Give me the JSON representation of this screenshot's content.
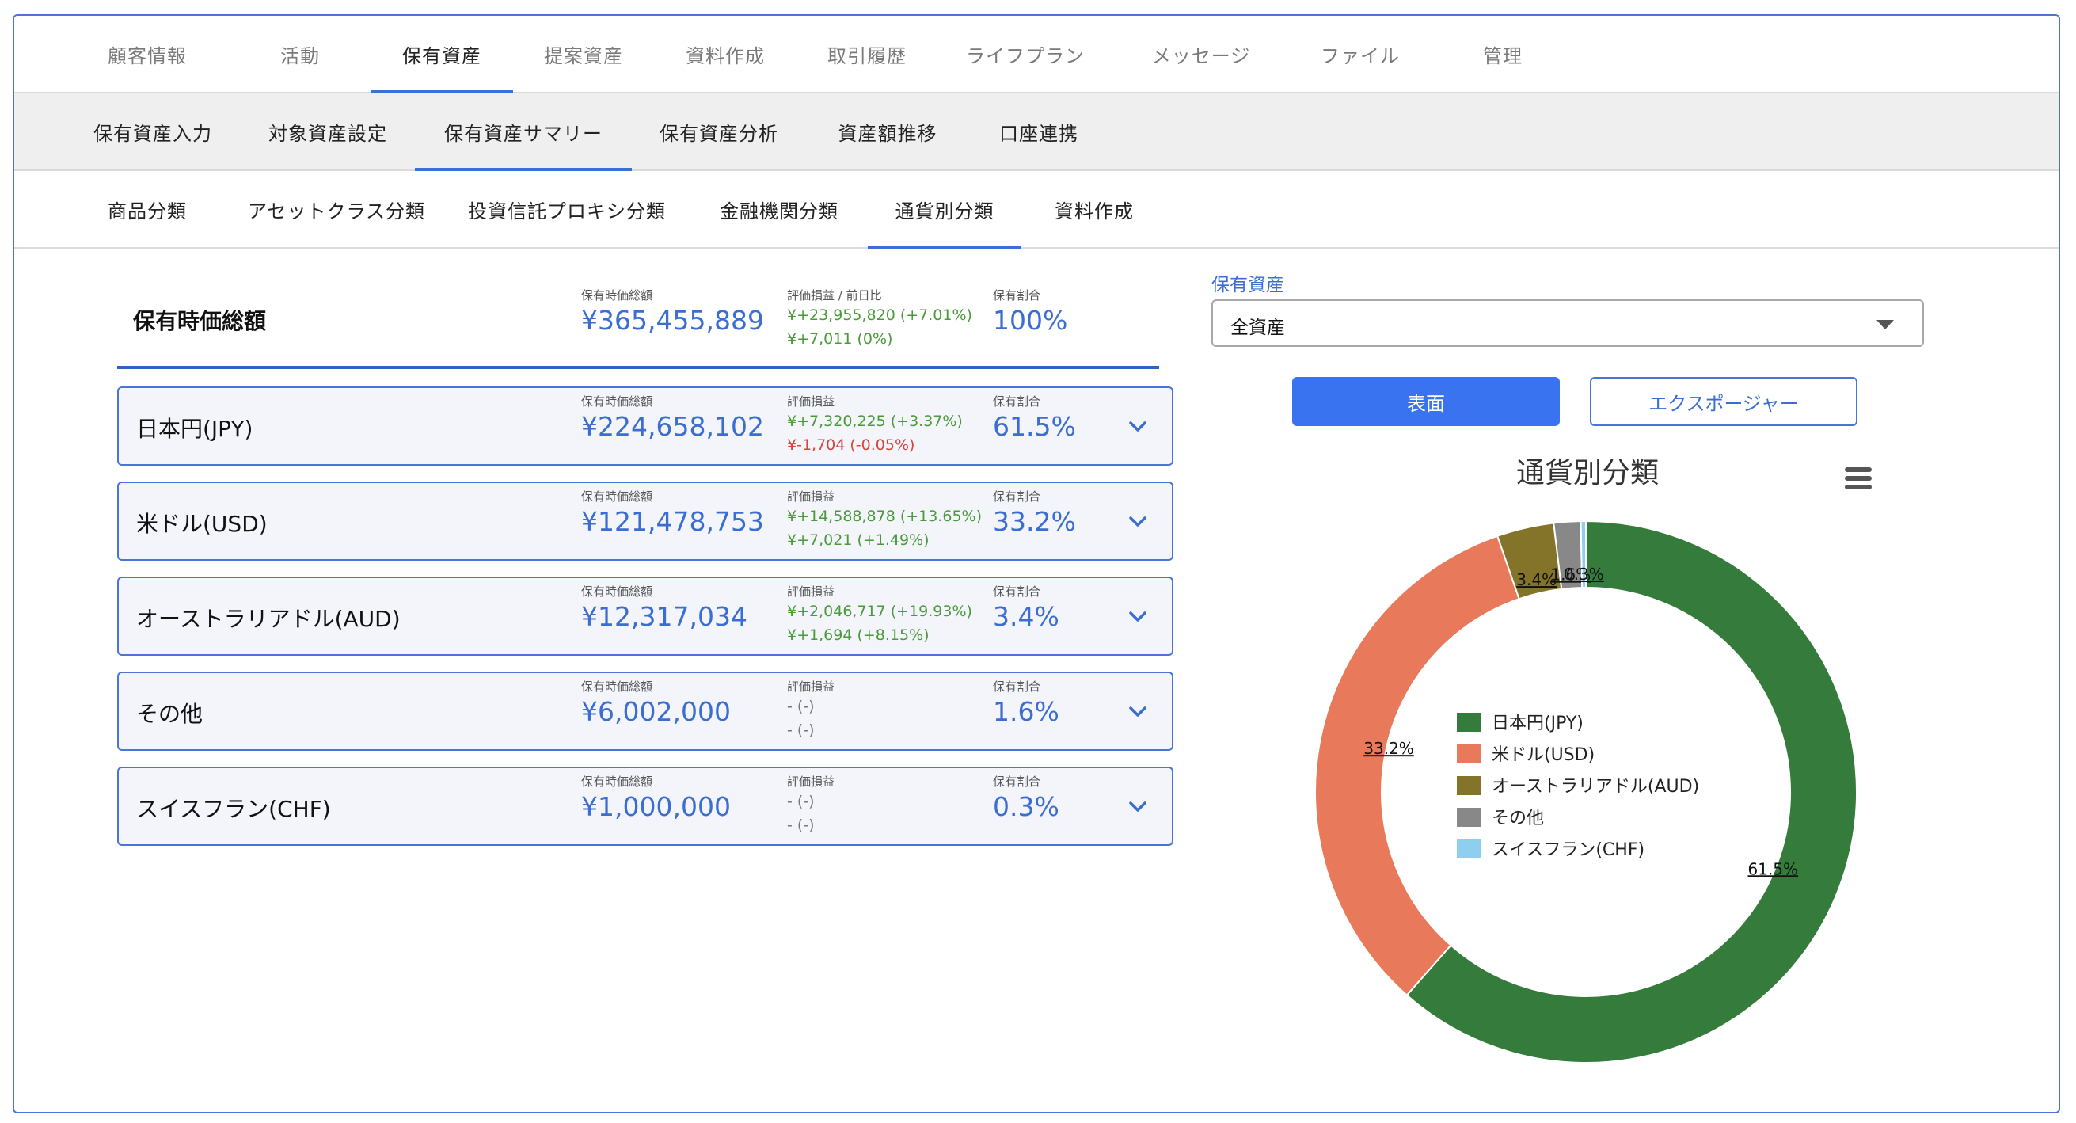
{
  "nav1": [
    "顧客情報",
    "活動",
    "保有資産",
    "提案資産",
    "資料作成",
    "取引履歴",
    "ライフプラン",
    "メッセージ",
    "ファイル",
    "管理"
  ],
  "nav2": [
    "保有資産入力",
    "対象資産設定",
    "保有資産サマリー",
    "保有資産分析",
    "資産額推移",
    "口座連携"
  ],
  "nav3": [
    "商品分類",
    "アセットクラス分類",
    "投資信託プロキシ分類",
    "金融機関分類",
    "通貨別分類",
    "資料作成"
  ],
  "summary": {
    "title": "保有時価総額",
    "value_label": "保有時価総額",
    "value": "¥365,455,889",
    "pl_label": "評価損益 / 前日比",
    "pl_line1": "¥+23,955,820 (+7.01%)",
    "pl_line2": "¥+7,011 (0%)",
    "share_label": "保有割合",
    "share": "100%"
  },
  "rows": [
    {
      "name": "日本円(JPY)",
      "value_label": "保有時価総額",
      "value": "¥224,658,102",
      "pl_label": "評価損益",
      "pl_line1": "¥+7,320,225 (+3.37%)",
      "pl_line2": "¥-1,704 (-0.05%)",
      "share_label": "保有割合",
      "share": "61.5%"
    },
    {
      "name": "米ドル(USD)",
      "value_label": "保有時価総額",
      "value": "¥121,478,753",
      "pl_label": "評価損益",
      "pl_line1": "¥+14,588,878 (+13.65%)",
      "pl_line2": "¥+7,021 (+1.49%)",
      "share_label": "保有割合",
      "share": "33.2%"
    },
    {
      "name": "オーストラリアドル(AUD)",
      "value_label": "保有時価総額",
      "value": "¥12,317,034",
      "pl_label": "評価損益",
      "pl_line1": "¥+2,046,717 (+19.93%)",
      "pl_line2": "¥+1,694 (+8.15%)",
      "share_label": "保有割合",
      "share": "3.4%"
    },
    {
      "name": "その他",
      "value_label": "保有時価総額",
      "value": "¥6,002,000",
      "pl_label": "評価損益",
      "pl_line1": "- (-)",
      "pl_line2": "- (-)",
      "share_label": "保有割合",
      "share": "1.6%"
    },
    {
      "name": "スイスフラン(CHF)",
      "value_label": "保有時価総額",
      "value": "¥1,000,000",
      "pl_label": "評価損益",
      "pl_line1": "- (-)",
      "pl_line2": "- (-)",
      "share_label": "保有割合",
      "share": "0.3%"
    }
  ],
  "right": {
    "select_label": "保有資産",
    "select_value": "全資産",
    "btn_primary": "表面",
    "btn_secondary": "エクスポージャー"
  },
  "chart_data": {
    "type": "pie",
    "title": "通貨別分類",
    "categories": [
      "日本円(JPY)",
      "米ドル(USD)",
      "オーストラリアドル(AUD)",
      "その他",
      "スイスフラン(CHF)"
    ],
    "values": [
      61.5,
      33.2,
      3.4,
      1.6,
      0.3
    ],
    "labels": [
      "61.5%",
      "33.2%",
      "3.4%",
      "1.6%",
      "0.3%"
    ],
    "colors": [
      "#357c3c",
      "#e8795a",
      "#84742a",
      "#888888",
      "#8ecff0"
    ],
    "legend": "center",
    "donut": true
  },
  "colors": {
    "accent": "#3b6ed0",
    "frame": "#4a74d8",
    "positive": "#4a9a3a",
    "negative": "#d6453d"
  }
}
